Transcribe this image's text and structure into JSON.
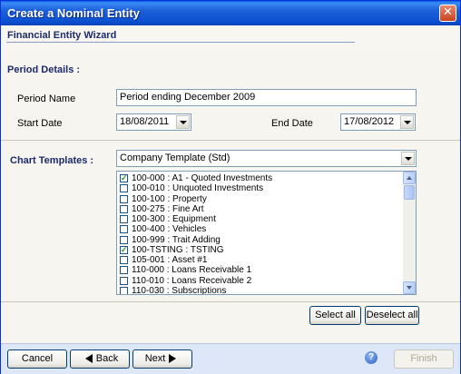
{
  "window": {
    "title": "Create a Nominal Entity"
  },
  "wizard": {
    "header": "Financial Entity Wizard"
  },
  "period": {
    "section_label": "Period Details :",
    "name_label": "Period Name",
    "name_value": "Period ending December 2009",
    "start_label": "Start Date",
    "start_value": "18/08/2011",
    "end_label": "End Date",
    "end_value": "17/08/2012"
  },
  "templates": {
    "section_label": "Chart Templates :",
    "selected": "Company Template (Std)",
    "items": [
      {
        "label": "100-000 : A1 - Quoted Investments",
        "checked": true
      },
      {
        "label": "100-010 : Unquoted Investments",
        "checked": false
      },
      {
        "label": "100-100 : Property",
        "checked": false
      },
      {
        "label": "100-275 : Fine Art",
        "checked": false
      },
      {
        "label": "100-300 : Equipment",
        "checked": false
      },
      {
        "label": "100-400 : Vehicles",
        "checked": false
      },
      {
        "label": "100-999 : Trait Adding",
        "checked": false
      },
      {
        "label": "100-TSTING : TSTING",
        "checked": true
      },
      {
        "label": "105-001 : Asset #1",
        "checked": false
      },
      {
        "label": "110-000 : Loans Receivable 1",
        "checked": false
      },
      {
        "label": "110-010 : Loans Receivable 2",
        "checked": false
      },
      {
        "label": "110-030 : Subscriptions",
        "checked": false
      }
    ],
    "select_all": "Select all",
    "deselect_all": "Deselect all"
  },
  "footer": {
    "cancel": "Cancel",
    "back": "Back",
    "next": "Next",
    "finish": "Finish",
    "help": "?"
  }
}
